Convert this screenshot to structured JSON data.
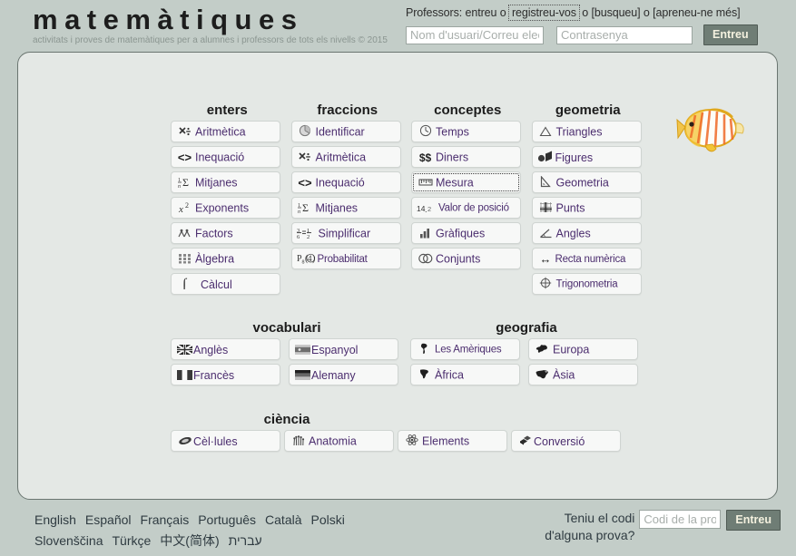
{
  "header": {
    "site_title": "matemàtiques",
    "site_subtitle": "activitats i proves de matemàtiques per a alumnes i professors de tots els nivells © 2015",
    "professors_prefix": "Professors: entreu o",
    "register_link": "registreu-vos",
    "sep1": "o",
    "search_link": "[busqueu]",
    "sep2": "o",
    "learn_more_link": "[apreneu-ne més]",
    "username_placeholder": "Nom d'usuari/Correu electrònic",
    "password_placeholder": "Contrasenya",
    "login_button": "Entreu"
  },
  "panel": {
    "decoration_icon": "butterflyfish-image",
    "groups": [
      {
        "id": "enters",
        "heading": "enters",
        "items": [
          {
            "label": "Aritmètica",
            "icon": "times-divide-icon"
          },
          {
            "label": "Inequació",
            "icon": "less-greater-icon"
          },
          {
            "label": "Mitjanes",
            "icon": "mean-sigma-icon"
          },
          {
            "label": "Exponents",
            "icon": "x-squared-icon"
          },
          {
            "label": "Factors",
            "icon": "factor-tree-icon"
          },
          {
            "label": "Àlgebra",
            "icon": "grid-blocks-icon"
          },
          {
            "label": "Càlcul",
            "icon": "integral-icon"
          }
        ]
      },
      {
        "id": "fraccions",
        "heading": "fraccions",
        "items": [
          {
            "label": "Identificar",
            "icon": "pie-chart-icon"
          },
          {
            "label": "Aritmètica",
            "icon": "times-divide-icon"
          },
          {
            "label": "Inequació",
            "icon": "less-greater-icon"
          },
          {
            "label": "Mitjanes",
            "icon": "mean-sigma-icon"
          },
          {
            "label": "Simplificar",
            "icon": "fraction-equal-icon"
          },
          {
            "label": "Probabilitat",
            "icon": "probability-icon"
          }
        ]
      },
      {
        "id": "conceptes",
        "heading": "conceptes",
        "items": [
          {
            "label": "Temps",
            "icon": "clock-icon"
          },
          {
            "label": "Diners",
            "icon": "dollar-signs-icon"
          },
          {
            "label": "Mesura",
            "icon": "ruler-icon",
            "focused": true
          },
          {
            "label": "Valor de posició",
            "icon": "decimal-number-icon"
          },
          {
            "label": "Gràfiques",
            "icon": "bar-chart-icon"
          },
          {
            "label": "Conjunts",
            "icon": "venn-diagram-icon"
          }
        ]
      },
      {
        "id": "geometria",
        "heading": "geometria",
        "items": [
          {
            "label": "Triangles",
            "icon": "triangle-icon"
          },
          {
            "label": "Figures",
            "icon": "solids-icon"
          },
          {
            "label": "Geometria",
            "icon": "set-square-icon"
          },
          {
            "label": "Punts",
            "icon": "coordinate-grid-icon"
          },
          {
            "label": "Angles",
            "icon": "angle-icon"
          },
          {
            "label": "Recta numèrica",
            "icon": "double-arrow-icon"
          },
          {
            "label": "Trigonometria",
            "icon": "unit-circle-icon"
          }
        ]
      },
      {
        "id": "vocabulari",
        "heading": "vocabulari",
        "items": [
          {
            "label": "Anglès",
            "icon": "flag-uk-icon"
          },
          {
            "label": "Espanyol",
            "icon": "flag-spain-icon"
          },
          {
            "label": "Francès",
            "icon": "flag-france-icon"
          },
          {
            "label": "Alemany",
            "icon": "flag-germany-icon"
          }
        ]
      },
      {
        "id": "geografia",
        "heading": "geografia",
        "items": [
          {
            "label": "Les Amèriques",
            "icon": "map-americas-icon"
          },
          {
            "label": "Europa",
            "icon": "map-europe-icon"
          },
          {
            "label": "Àfrica",
            "icon": "map-africa-icon"
          },
          {
            "label": "Àsia",
            "icon": "map-asia-icon"
          }
        ]
      },
      {
        "id": "ciencia",
        "heading": "ciència",
        "items": [
          {
            "label": "Cèl·lules",
            "icon": "cell-icon"
          },
          {
            "label": "Anatomia",
            "icon": "hand-bones-icon"
          },
          {
            "label": "Elements",
            "icon": "atom-icon"
          },
          {
            "label": "Conversió",
            "icon": "cubes-icon"
          }
        ]
      }
    ]
  },
  "footer": {
    "languages": [
      "English",
      "Español",
      "Français",
      "Português",
      "Català",
      "Polski",
      "Slovenščina",
      "Türkçe",
      "中文(简体)",
      "עברית"
    ],
    "code_question_line1": "Teniu el codi",
    "code_question_line2": "d'alguna prova?",
    "code_placeholder": "Codi de la prova",
    "code_button": "Entreu"
  },
  "colors": {
    "page_bg": "#c3cdc8",
    "panel_bg": "#e4e8e5",
    "link_purple": "#4b2d6e",
    "button_green": "#6f7d75",
    "button_text": "#f4f1df"
  }
}
